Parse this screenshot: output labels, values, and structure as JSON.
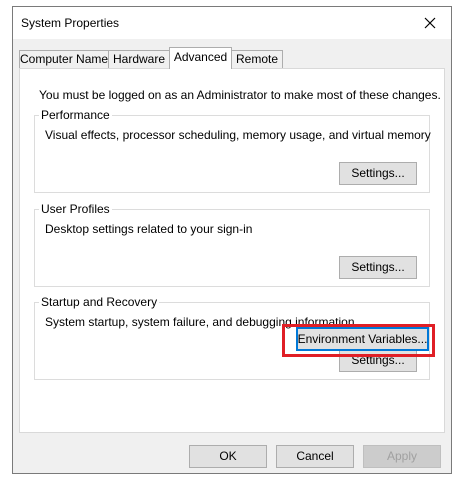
{
  "window": {
    "title": "System Properties",
    "close_glyph": "close-icon"
  },
  "tabs": [
    {
      "label": "Computer Name",
      "active": false
    },
    {
      "label": "Hardware",
      "active": false
    },
    {
      "label": "Advanced",
      "active": true
    },
    {
      "label": "Remote",
      "active": false
    }
  ],
  "advanced": {
    "notice": "You must be logged on as an Administrator to make most of these changes.",
    "performance": {
      "title": "Performance",
      "description": "Visual effects, processor scheduling, memory usage, and virtual memory",
      "button": "Settings..."
    },
    "user_profiles": {
      "title": "User Profiles",
      "description": "Desktop settings related to your sign-in",
      "button": "Settings..."
    },
    "startup_recovery": {
      "title": "Startup and Recovery",
      "description": "System startup, system failure, and debugging information",
      "button": "Settings..."
    },
    "environment_button": "Environment Variables..."
  },
  "footer": {
    "ok": "OK",
    "cancel": "Cancel",
    "apply": "Apply"
  },
  "colors": {
    "highlight": "#e01f26",
    "focus": "#0078d7"
  }
}
